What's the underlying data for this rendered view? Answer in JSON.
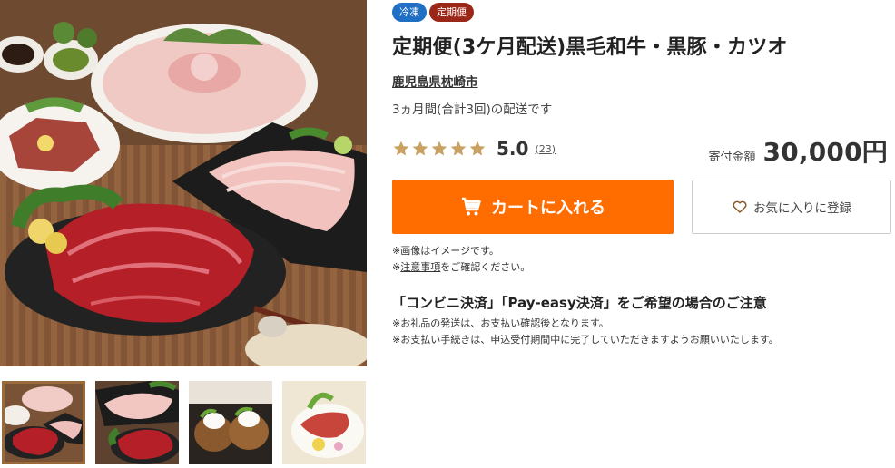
{
  "gallery": {
    "main_image_alt": "product-photo-beef-pork-bonito-platter",
    "thumbnails": [
      {
        "name": "thumb-platter",
        "active": true
      },
      {
        "name": "thumb-pork-and-beef",
        "active": false
      },
      {
        "name": "thumb-rice-cakes",
        "active": false
      },
      {
        "name": "thumb-bonito-sashimi",
        "active": false
      }
    ]
  },
  "badges": {
    "frozen": "冷凍",
    "subscription": "定期便"
  },
  "product": {
    "title": "定期便(3ケ月配送)黒毛和牛・黒豚・カツオ",
    "municipality": "鹿児島県枕崎市",
    "delivery_description": "3ヵ月間(合計3回)の配送です"
  },
  "rating": {
    "stars": 5,
    "value": "5.0",
    "count": "23",
    "open_paren": "(",
    "close_paren": ")",
    "star_color": "#c9a162"
  },
  "price": {
    "label": "寄付金額",
    "value": "30,000円"
  },
  "actions": {
    "cart_label": "カートに入れる",
    "favorite_label": "お気に入りに登録",
    "accent_color": "#ff6d00"
  },
  "notes": {
    "line1": "※画像はイメージです。",
    "line2_prefix": "※",
    "line2_link": "注意事項",
    "line2_suffix": "をご確認ください。"
  },
  "payment": {
    "heading": "「コンビニ決済」「Pay-easy決済」をご希望の場合のご注意",
    "note1": "※お礼品の発送は、お支払い確認後となります。",
    "note2": "※お支払い手続きは、申込受付期間中に完了していただきますようお願いいたします。"
  }
}
